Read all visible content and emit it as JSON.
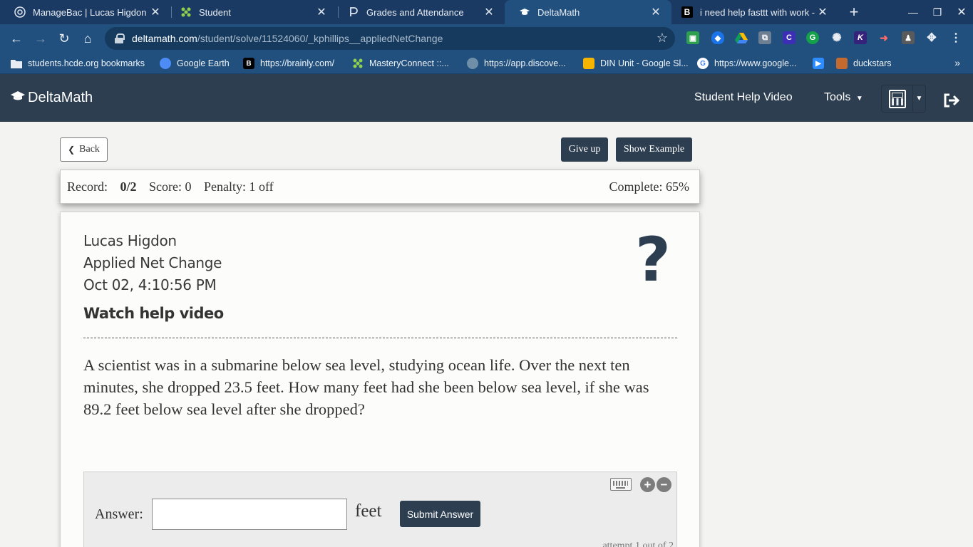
{
  "browser": {
    "tabs": [
      {
        "title": "ManageBac | Lucas Higdon",
        "icon": "managebac-icon"
      },
      {
        "title": "Student",
        "icon": "masteryconnect-icon"
      },
      {
        "title": "Grades and Attendance",
        "icon": "powerschool-icon"
      },
      {
        "title": "DeltaMath",
        "icon": "deltamath-icon"
      },
      {
        "title": "i need help fasttt with work - B",
        "icon": "brainly-icon"
      }
    ],
    "url_host": "deltamath.com",
    "url_path": "/student/solve/11524060/_kphillips__appliedNetChange",
    "bookmarks": [
      {
        "label": "students.hcde.org bookmarks",
        "icon": "folder-icon"
      },
      {
        "label": "Google Earth",
        "icon": "google-earth-icon"
      },
      {
        "label": "https://brainly.com/",
        "icon": "brainly-icon"
      },
      {
        "label": "MasteryConnect ::...",
        "icon": "masteryconnect-icon"
      },
      {
        "label": "https://app.discove...",
        "icon": "globe-icon"
      },
      {
        "label": "DIN Unit - Google Sl...",
        "icon": "google-slides-icon"
      },
      {
        "label": "https://www.google...",
        "icon": "google-icon"
      },
      {
        "label": "",
        "icon": "zoom-icon"
      },
      {
        "label": "duckstars",
        "icon": "duck-icon"
      }
    ]
  },
  "navbar": {
    "brand": "DeltaMath",
    "help_video": "Student Help Video",
    "tools": "Tools"
  },
  "actions": {
    "back": "Back",
    "give_up": "Give up",
    "show_example": "Show Example"
  },
  "record": {
    "record_label": "Record:",
    "record_value": "0/2",
    "score": "Score: 0",
    "penalty": "Penalty: 1 off",
    "complete": "Complete: 65%"
  },
  "problem": {
    "student_name": "Lucas Higdon",
    "skill": "Applied Net Change",
    "timestamp": "Oct 02, 4:10:56 PM",
    "help_link": "Watch help video",
    "text": "A scientist was in a submarine below sea level, studying ocean life. Over the next ten minutes, she dropped 23.5 feet. How many feet had she been below sea level, if she was 89.2 feet below sea level after she dropped?",
    "answer_label": "Answer:",
    "answer_value": "",
    "unit": "feet",
    "submit": "Submit Answer",
    "attempt": "attempt 1 out of 2"
  },
  "colors": {
    "navbar": "#2d3e50",
    "button_dark": "#2d3e50",
    "chrome_tabstrip": "#1b3a63",
    "chrome_toolbar": "#22507e"
  }
}
